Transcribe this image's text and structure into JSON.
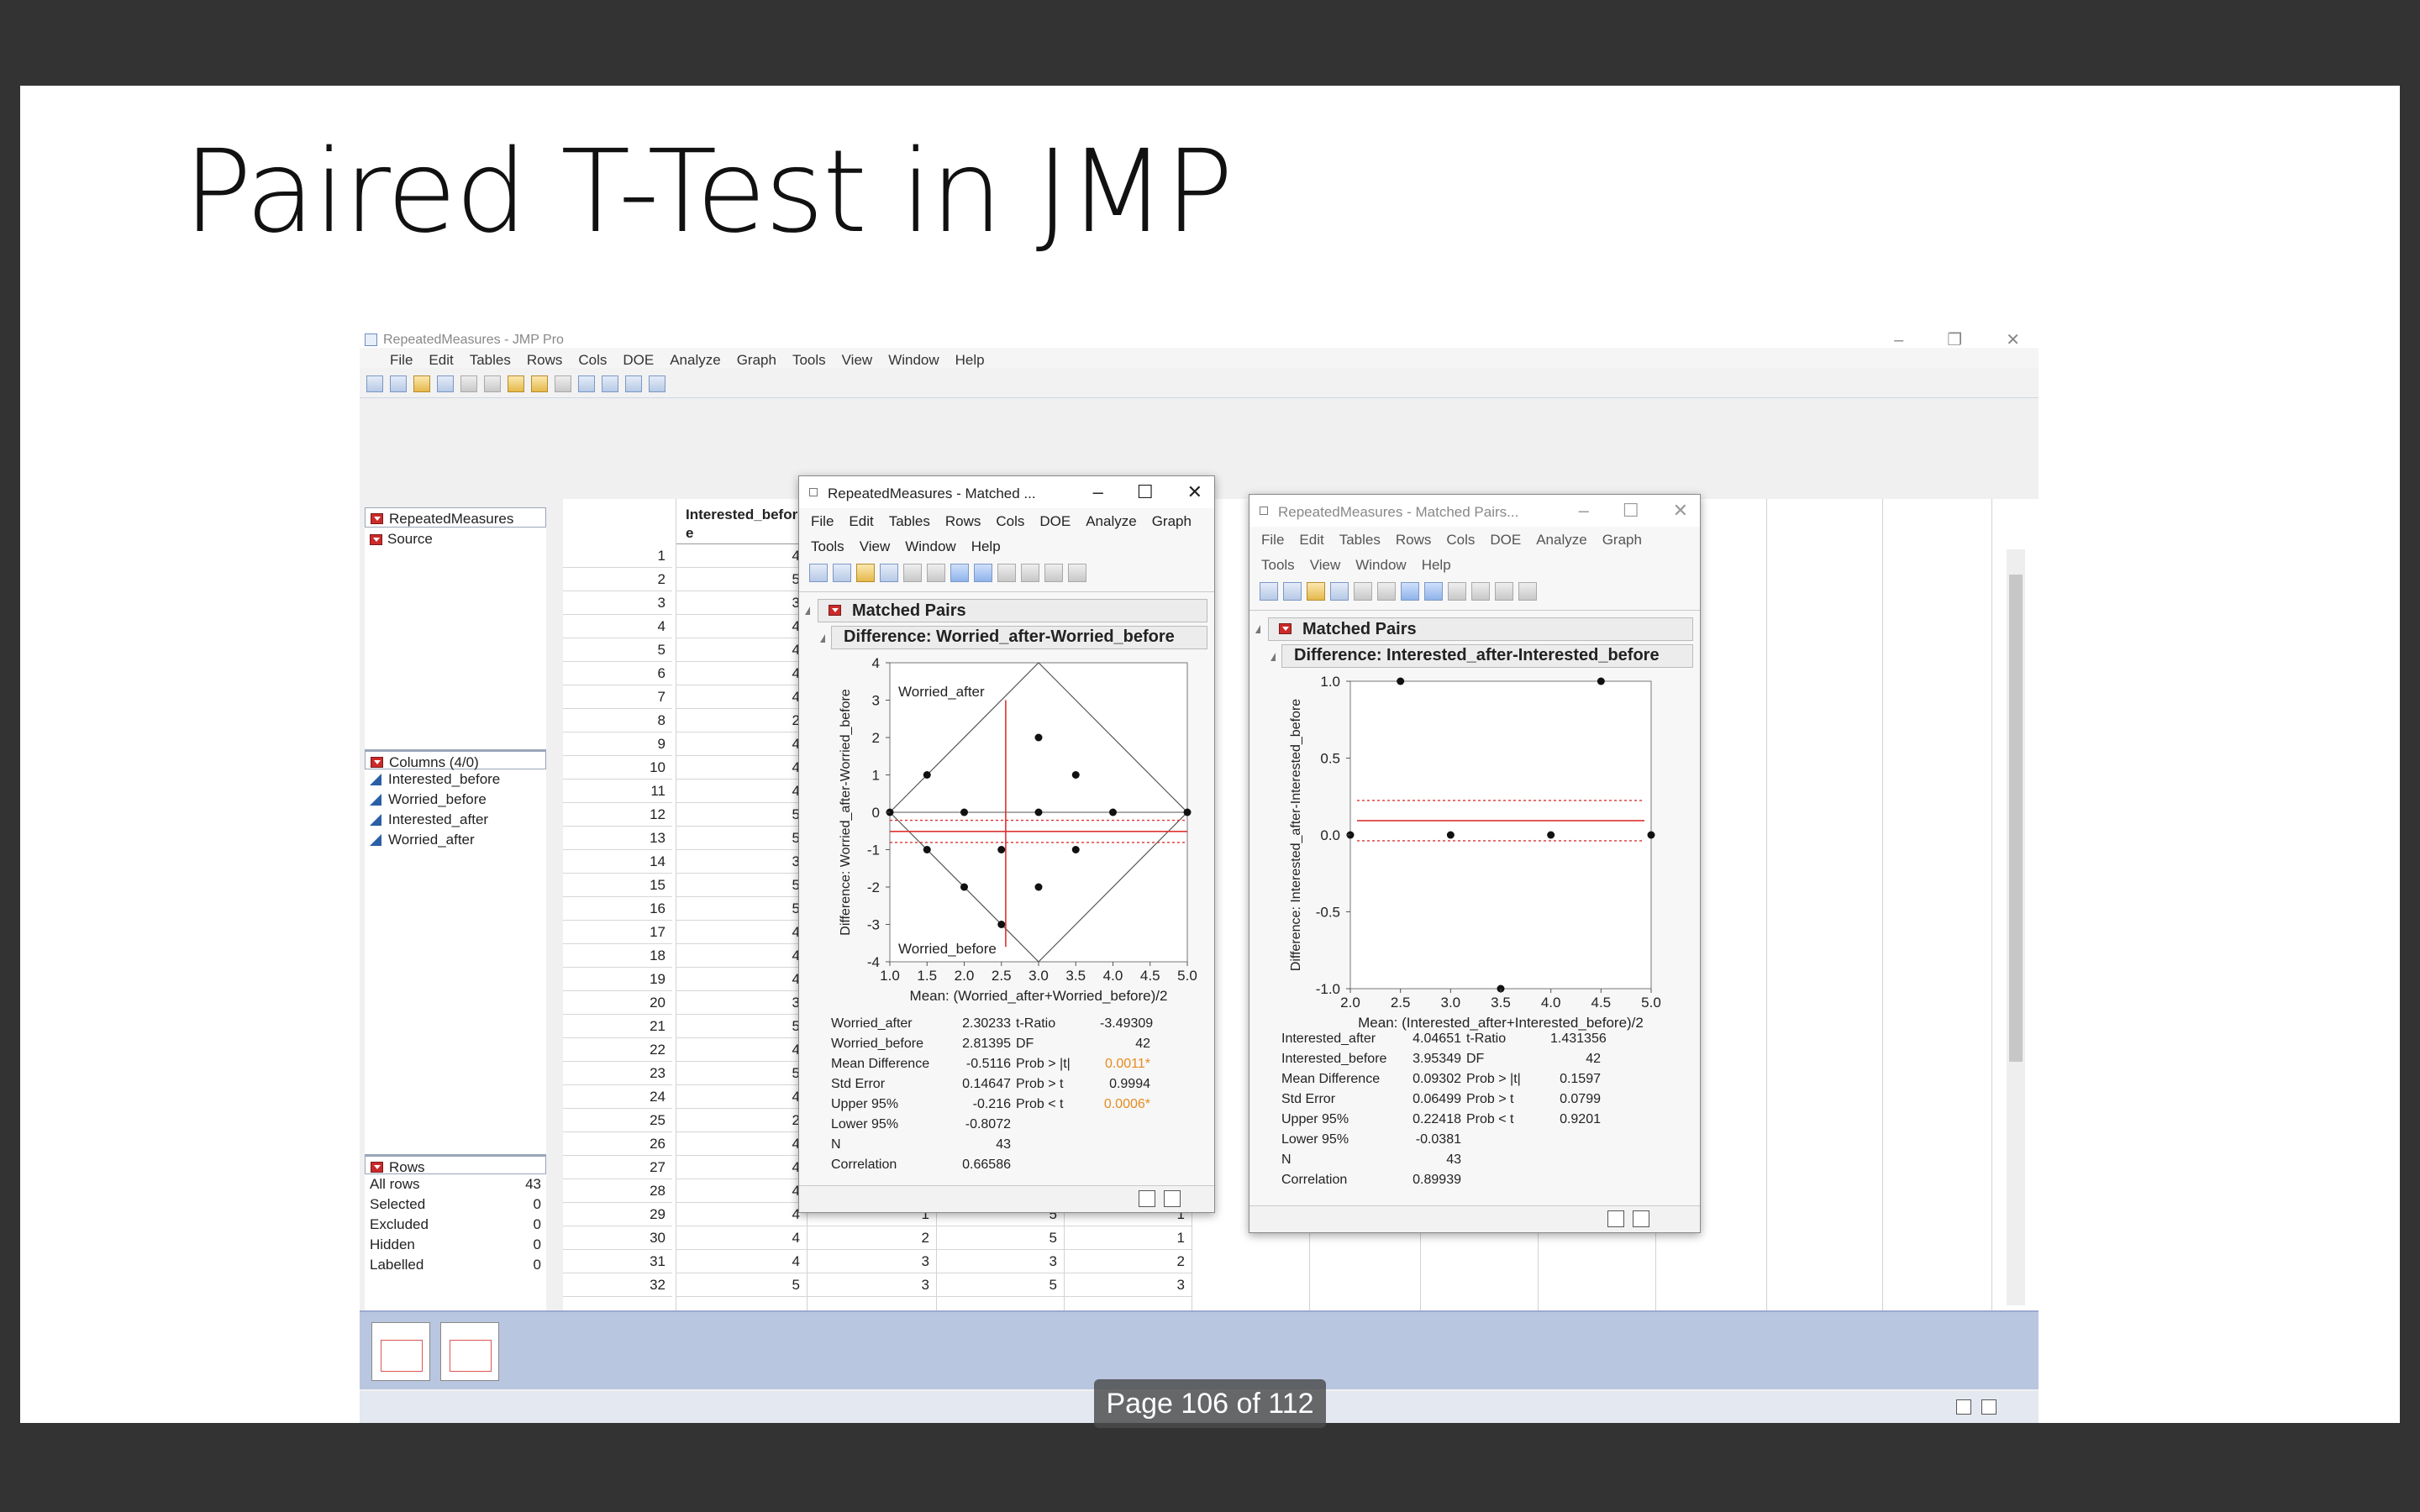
{
  "slide": {
    "title": "Paired T-Test in JMP",
    "pager": "Page 106 of 112"
  },
  "jmp": {
    "window_title": "RepeatedMeasures - JMP Pro",
    "menu": [
      "File",
      "Edit",
      "Tables",
      "Rows",
      "Cols",
      "DOE",
      "Analyze",
      "Graph",
      "Tools",
      "View",
      "Window",
      "Help"
    ],
    "left_panel": {
      "table_name": "RepeatedMeasures",
      "source": "Source",
      "columns_header": "Columns (4/0)",
      "columns": [
        "Interested_before",
        "Worried_before",
        "Interested_after",
        "Worried_after"
      ],
      "rows_header": "Rows",
      "rows_stats": [
        {
          "label": "All rows",
          "value": "43"
        },
        {
          "label": "Selected",
          "value": "0"
        },
        {
          "label": "Excluded",
          "value": "0"
        },
        {
          "label": "Hidden",
          "value": "0"
        },
        {
          "label": "Labelled",
          "value": "0"
        }
      ]
    },
    "grid": {
      "col_header": "Interested_befor e",
      "row_numbers": [
        "1",
        "2",
        "3",
        "4",
        "5",
        "6",
        "7",
        "8",
        "9",
        "10",
        "11",
        "12",
        "13",
        "14",
        "15",
        "16",
        "17",
        "18",
        "19",
        "20",
        "21",
        "22",
        "23",
        "24",
        "25",
        "26",
        "27",
        "28",
        "29",
        "30",
        "31",
        "32"
      ],
      "partial_col1": [
        "4",
        "5",
        "3",
        "4",
        "4",
        "4",
        "4",
        "2",
        "4",
        "4",
        "4",
        "5",
        "5",
        "3",
        "5",
        "5",
        "4",
        "4",
        "4",
        "3",
        "5",
        "4",
        "5",
        "4",
        "2",
        "4",
        "4",
        "4"
      ],
      "tail_rows": [
        {
          "c1": "4",
          "c2": "1",
          "c3": "5",
          "c4": "1"
        },
        {
          "c1": "4",
          "c2": "2",
          "c3": "5",
          "c4": "1"
        },
        {
          "c1": "4",
          "c2": "3",
          "c3": "3",
          "c4": "2"
        },
        {
          "c1": "5",
          "c2": "3",
          "c3": "5",
          "c4": "3"
        }
      ]
    },
    "popup1": {
      "title": "RepeatedMeasures - Matched ...",
      "menu_row1": [
        "File",
        "Edit",
        "Tables",
        "Rows",
        "Cols",
        "DOE",
        "Analyze",
        "Graph"
      ],
      "menu_row2": [
        "Tools",
        "View",
        "Window",
        "Help"
      ],
      "header": "Matched Pairs",
      "subheader": "Difference: Worried_after-Worried_before",
      "stats": [
        [
          "Worried_after",
          "2.30233",
          "t-Ratio",
          "-3.49309"
        ],
        [
          "Worried_before",
          "2.81395",
          "DF",
          "42"
        ],
        [
          "Mean Difference",
          "-0.5116",
          "Prob > |t|",
          "0.0011*"
        ],
        [
          "Std Error",
          "0.14647",
          "Prob > t",
          "0.9994"
        ],
        [
          "Upper 95%",
          "-0.216",
          "Prob < t",
          "0.0006*"
        ],
        [
          "Lower 95%",
          "-0.8072",
          "",
          ""
        ],
        [
          "N",
          "43",
          "",
          ""
        ],
        [
          "Correlation",
          "0.66586",
          "",
          ""
        ]
      ]
    },
    "popup2": {
      "title": "RepeatedMeasures - Matched Pairs...",
      "menu_row1": [
        "File",
        "Edit",
        "Tables",
        "Rows",
        "Cols",
        "DOE",
        "Analyze",
        "Graph"
      ],
      "menu_row2": [
        "Tools",
        "View",
        "Window",
        "Help"
      ],
      "header": "Matched Pairs",
      "subheader": "Difference: Interested_after-Interested_before",
      "stats": [
        [
          "Interested_after",
          "4.04651",
          "t-Ratio",
          "1.431356"
        ],
        [
          "Interested_before",
          "3.95349",
          "DF",
          "42"
        ],
        [
          "Mean Difference",
          "0.09302",
          "Prob > |t|",
          "0.1597"
        ],
        [
          "Std Error",
          "0.06499",
          "Prob > t",
          "0.0799"
        ],
        [
          "Upper 95%",
          "0.22418",
          "Prob < t",
          "0.9201"
        ],
        [
          "Lower 95%",
          "-0.0381",
          "",
          ""
        ],
        [
          "N",
          "43",
          "",
          ""
        ],
        [
          "Correlation",
          "0.89939",
          "",
          ""
        ]
      ]
    }
  },
  "chart_data": [
    {
      "type": "scatter",
      "xlabel": "Mean: (Worried_after+Worried_before)/2",
      "ylabel": "Difference: Worried_after-Worried_before",
      "xlim": [
        1.0,
        5.0
      ],
      "ylim": [
        -4,
        4
      ],
      "x_ticks": [
        "1.0",
        "1.5",
        "2.0",
        "2.5",
        "3.0",
        "3.5",
        "4.0",
        "4.5",
        "5.0"
      ],
      "y_ticks": [
        "4",
        "3",
        "2",
        "1",
        "0",
        "-1",
        "-2",
        "-3",
        "-4"
      ],
      "annotations": [
        "Worried_after",
        "Worried_before"
      ],
      "points": [
        [
          1.5,
          1
        ],
        [
          2.0,
          0
        ],
        [
          3.0,
          2
        ],
        [
          3.5,
          1
        ],
        [
          3.0,
          0
        ],
        [
          4.0,
          0
        ],
        [
          5.0,
          0
        ],
        [
          1.0,
          0
        ],
        [
          1.5,
          -1
        ],
        [
          2.5,
          -1
        ],
        [
          3.5,
          -1
        ],
        [
          2.0,
          -2
        ],
        [
          3.0,
          -2
        ],
        [
          2.5,
          -3
        ]
      ],
      "mean_difference": -0.5116,
      "upper_95": -0.216,
      "lower_95": -0.8072,
      "mean_x_line": 2.558
    },
    {
      "type": "scatter",
      "xlabel": "Mean: (Interested_after+Interested_before)/2",
      "ylabel": "Difference: Interested_after-Interested_before",
      "xlim": [
        2.0,
        5.0
      ],
      "ylim": [
        -1.0,
        1.0
      ],
      "x_ticks": [
        "2.0",
        "2.5",
        "3.0",
        "3.5",
        "4.0",
        "4.5",
        "5.0"
      ],
      "y_ticks": [
        "1.0",
        "0.5",
        "0.0",
        "-0.5",
        "-1.0"
      ],
      "points": [
        [
          2.5,
          1.0
        ],
        [
          4.5,
          1.0
        ],
        [
          2.0,
          0.0
        ],
        [
          3.0,
          0.0
        ],
        [
          4.0,
          0.0
        ],
        [
          5.0,
          0.0
        ],
        [
          3.5,
          -1.0
        ]
      ],
      "mean_difference": 0.09302,
      "upper_95": 0.22418,
      "lower_95": -0.0381
    }
  ]
}
